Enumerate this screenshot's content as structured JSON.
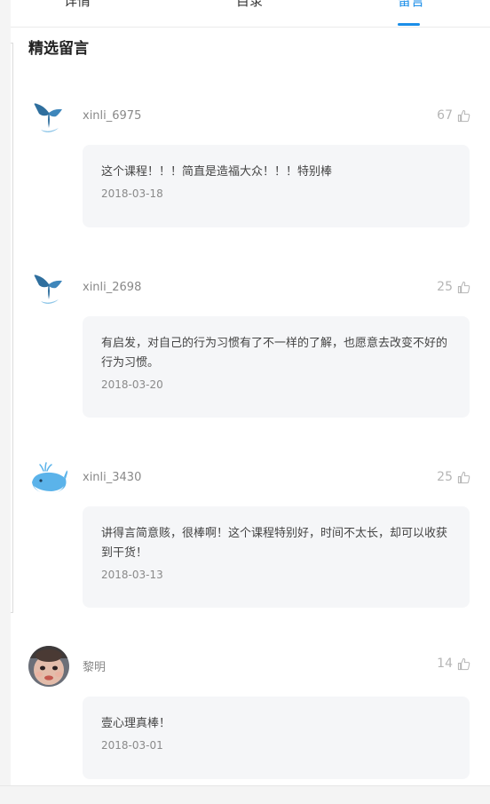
{
  "tabs": [
    {
      "label": "详情",
      "active": false
    },
    {
      "label": "目录",
      "active": false
    },
    {
      "label": "留言",
      "active": true
    }
  ],
  "accent_color": "#1b8ee8",
  "section_title": "精选留言",
  "comments": [
    {
      "avatar": "whale-tail-icon",
      "username": "xinli_6975",
      "likes": "67",
      "text": "这个课程！！！简直是造福大众！！！特别棒",
      "date": "2018-03-18"
    },
    {
      "avatar": "whale-tail-icon",
      "username": "xinli_2698",
      "likes": "25",
      "text": "有启发，对自己的行为习惯有了不一样的了解，也愿意去改变不好的行为习惯。",
      "date": "2018-03-20"
    },
    {
      "avatar": "whale-icon",
      "username": "xinli_3430",
      "likes": "25",
      "text": "讲得言简意赅，很棒啊！这个课程特别好，时间不太长，却可以收获到干货！",
      "date": "2018-03-13"
    },
    {
      "avatar": "baby-photo-avatar",
      "username": "黎明",
      "likes": "14",
      "text": "壹心理真棒！",
      "date": "2018-03-01"
    }
  ],
  "icons": {
    "like": "thumbs-up-icon"
  }
}
